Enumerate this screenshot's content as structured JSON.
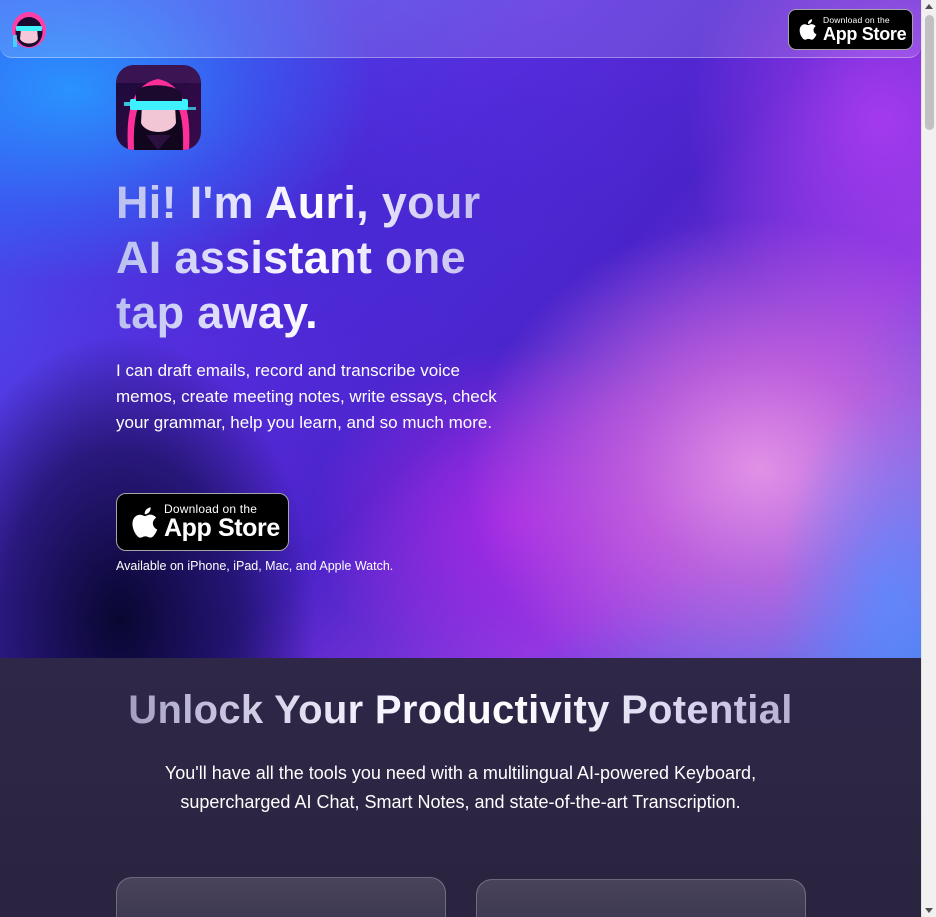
{
  "nav": {
    "logo_icon": "auri-avatar-icon",
    "badge_top": "Download on the",
    "badge_main": "App Store"
  },
  "hero": {
    "avatar_icon": "auri-avatar-icon",
    "title": "Hi! I'm Auri, your AI assistant one tap away.",
    "description": "I can draft emails, record and transcribe voice memos, create meeting notes, write essays, check your grammar, help you learn, and so much more.",
    "badge_top": "Download on the",
    "badge_main": "App Store",
    "availability": "Available on iPhone, iPad, Mac, and Apple Watch."
  },
  "features": {
    "title": "Unlock Your Productivity Potential",
    "description": "You'll have all the tools you need with a multilingual AI-powered Keyboard, supercharged AI Chat, Smart Notes, and state-of-the-art Transcription."
  },
  "colors": {
    "accent_pink": "#ff3fa8",
    "accent_cyan": "#37e3ff",
    "badge_bg": "#000000"
  }
}
